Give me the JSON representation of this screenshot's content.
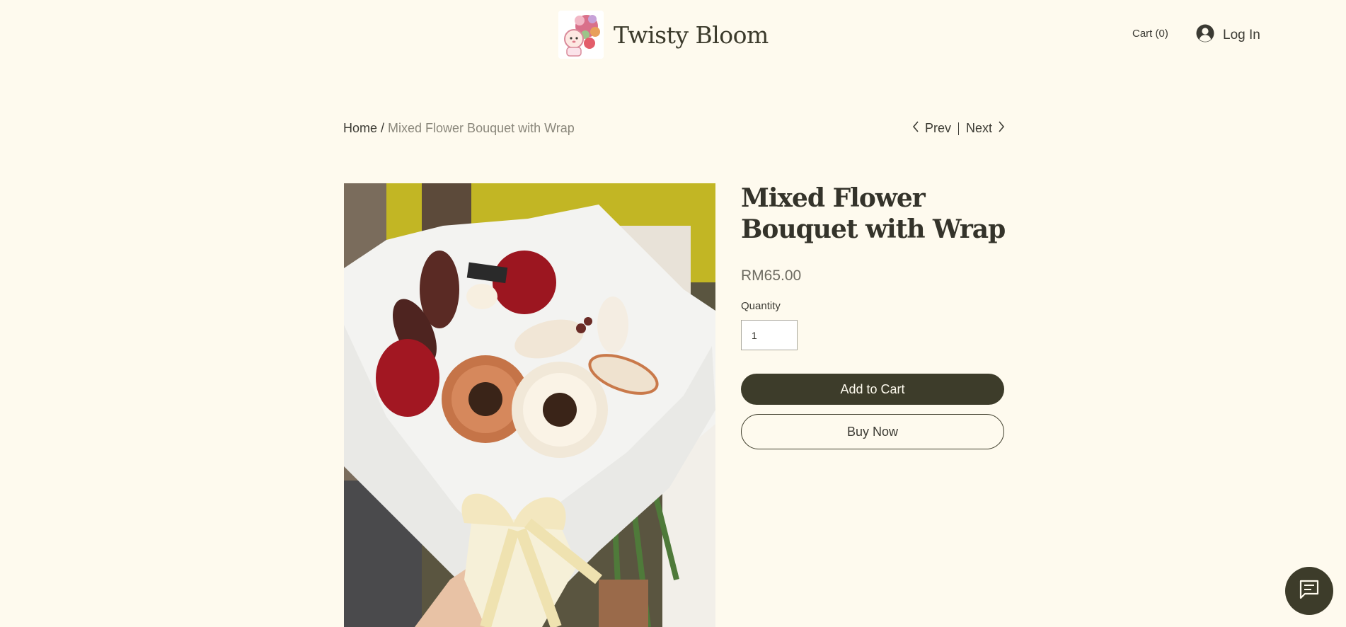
{
  "header": {
    "brand": "Twisty Bloom",
    "cart_label": "Cart (0)",
    "login_label": "Log In"
  },
  "breadcrumb": {
    "home": "Home",
    "separator": " / ",
    "current": "Mixed Flower Bouquet with Wrap"
  },
  "pager": {
    "prev": "Prev",
    "next": "Next"
  },
  "product": {
    "title": "Mixed Flower Bouquet with Wrap",
    "price": "RM65.00",
    "quantity_label": "Quantity",
    "quantity_value": "1",
    "add_to_cart": "Add to Cart",
    "buy_now": "Buy Now"
  },
  "colors": {
    "background": "#fefaee",
    "accent": "#3d3c2a",
    "text": "#3b3a33",
    "muted": "#8a877b"
  },
  "icons": {
    "login": "account-circle-icon",
    "prev": "chevron-left-icon",
    "next": "chevron-right-icon",
    "chat": "chat-icon"
  }
}
